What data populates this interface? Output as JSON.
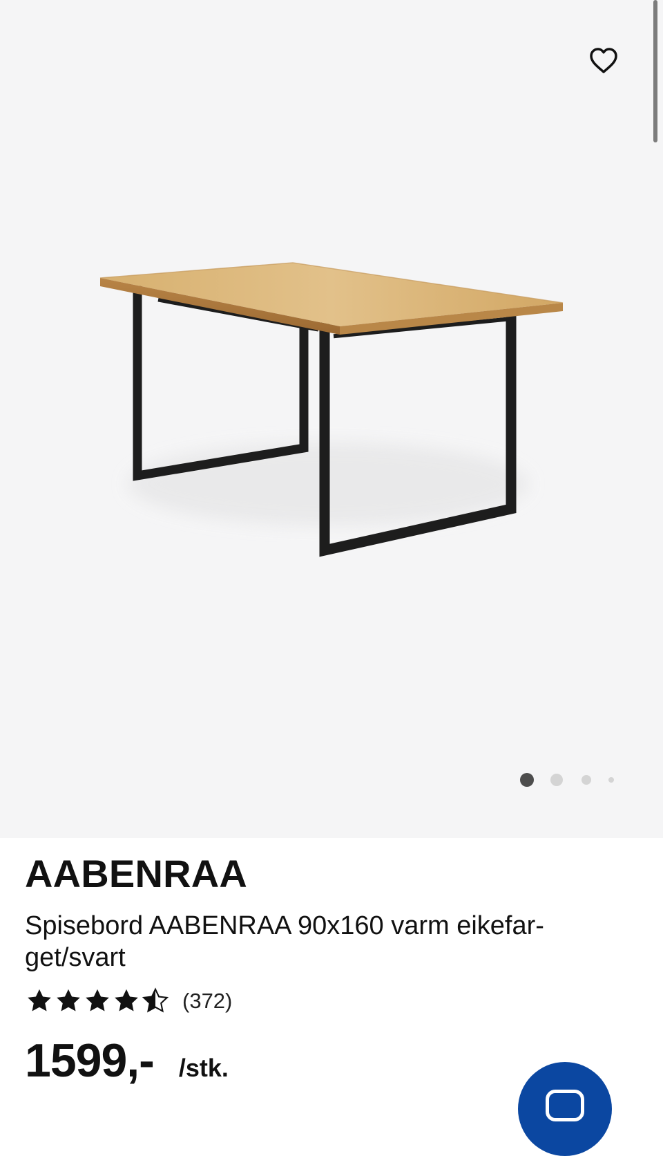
{
  "product": {
    "brand": "AABENRAA",
    "title": "Spisebord AABENRAA 90x160 varm eikefar-get/svart",
    "rating": {
      "value": 4.5,
      "max": 5,
      "count_label": "(372)"
    },
    "price": {
      "value": "1599,-",
      "unit": "/stk."
    }
  },
  "gallery": {
    "image_count": 4,
    "active_index": 0,
    "favorite_icon": "heart-icon",
    "colors": {
      "background": "#f5f5f6",
      "active_dot": "#4d4d4d",
      "inactive_dot": "#d4d4d4"
    }
  },
  "chat": {
    "icon": "chat-bubble-icon",
    "color": "#0b47a1"
  }
}
